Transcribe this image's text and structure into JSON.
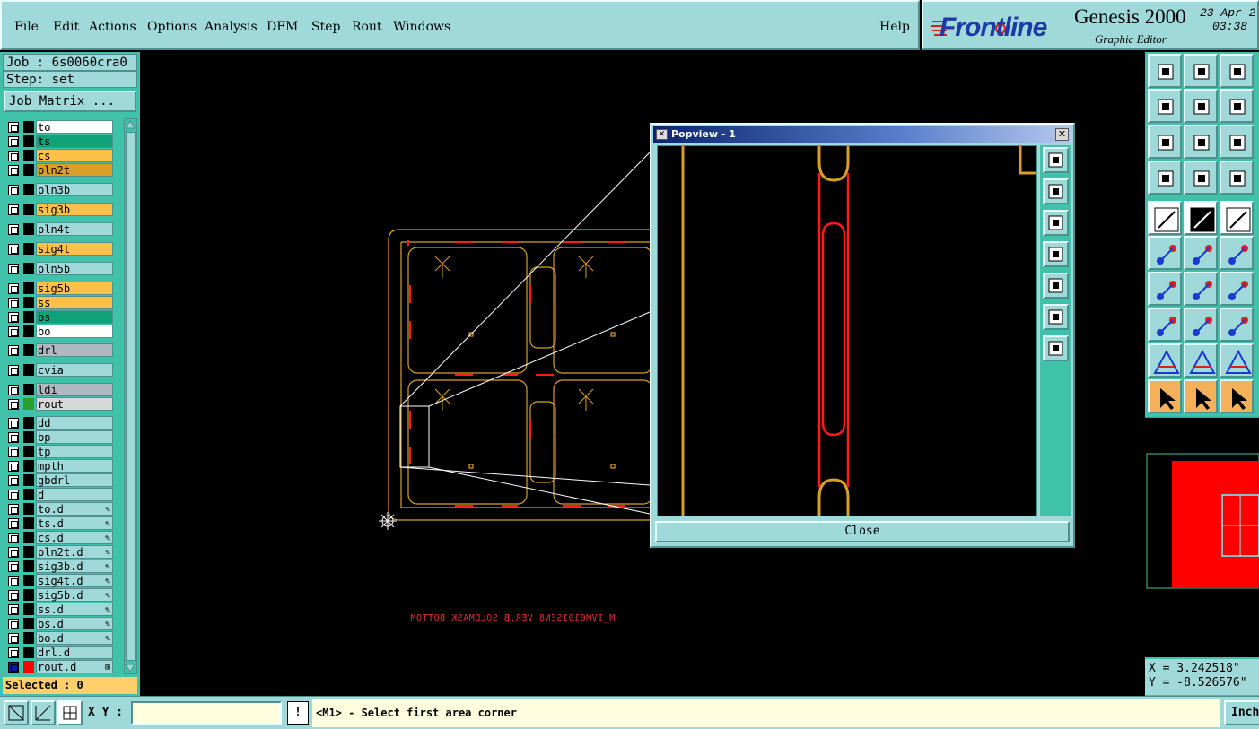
{
  "menu": {
    "items": [
      {
        "label": "File",
        "underline": true
      },
      {
        "label": "Edit",
        "underline": true
      },
      {
        "label": "Actions",
        "underline": true
      },
      {
        "label": "Options",
        "underline": false
      },
      {
        "label": "Analysis",
        "underline": false
      },
      {
        "label": "DFM",
        "underline": false
      },
      {
        "label": "Step",
        "underline": true
      },
      {
        "label": "Rout",
        "underline": true
      },
      {
        "label": "Windows",
        "underline": true
      }
    ],
    "help": "Help"
  },
  "brand": {
    "logo": "Frontline",
    "product": "Genesis 2000",
    "subtitle": "Graphic Editor",
    "date": "23 Apr 2",
    "time": "03:38"
  },
  "job": {
    "job_line": "Job : 6s0060cra0",
    "step_line": "Step: set",
    "matrix_button": "Job Matrix ..."
  },
  "layers": [
    {
      "name": "to",
      "color": "#ffffff",
      "swatch": "#000000",
      "mark": ""
    },
    {
      "name": "ts",
      "color": "#11a27a",
      "swatch": "#000000",
      "mark": ""
    },
    {
      "name": "cs",
      "color": "#ffc04a",
      "swatch": "#000000",
      "mark": ""
    },
    {
      "name": "pln2t",
      "color": "#d9a025",
      "swatch": "#000000",
      "mark": ""
    },
    {
      "name": "pln3b",
      "color": "#9fd9d9",
      "swatch": "#000000",
      "mark": ""
    },
    {
      "name": "sig3b",
      "color": "#ffc04a",
      "swatch": "#000000",
      "mark": ""
    },
    {
      "name": "pln4t",
      "color": "#9fd9d9",
      "swatch": "#000000",
      "mark": ""
    },
    {
      "name": "sig4t",
      "color": "#ffc04a",
      "swatch": "#000000",
      "mark": ""
    },
    {
      "name": "pln5b",
      "color": "#9fd9d9",
      "swatch": "#000000",
      "mark": ""
    },
    {
      "name": "sig5b",
      "color": "#ffc04a",
      "swatch": "#000000",
      "mark": ""
    },
    {
      "name": "ss",
      "color": "#ffc04a",
      "swatch": "#000000",
      "mark": ""
    },
    {
      "name": "bs",
      "color": "#11a27a",
      "swatch": "#000000",
      "mark": ""
    },
    {
      "name": "bo",
      "color": "#ffffff",
      "swatch": "#000000",
      "mark": ""
    },
    {
      "name": "drl",
      "color": "#b0b8c0",
      "swatch": "#000000",
      "mark": ""
    },
    {
      "name": "cvia",
      "color": "#9fd9d9",
      "swatch": "#000000",
      "mark": ""
    },
    {
      "name": "ldi",
      "color": "#b0b8c0",
      "swatch": "#000000",
      "mark": ""
    },
    {
      "name": "rout",
      "color": "#d8d8d8",
      "swatch": "#2aa02a",
      "mark": ""
    },
    {
      "name": "dd",
      "color": "#9fd9d9",
      "swatch": "#000000",
      "mark": ""
    },
    {
      "name": "bp",
      "color": "#9fd9d9",
      "swatch": "#000000",
      "mark": ""
    },
    {
      "name": "tp",
      "color": "#9fd9d9",
      "swatch": "#000000",
      "mark": ""
    },
    {
      "name": "mpth",
      "color": "#9fd9d9",
      "swatch": "#000000",
      "mark": ""
    },
    {
      "name": "gbdrl",
      "color": "#9fd9d9",
      "swatch": "#000000",
      "mark": ""
    },
    {
      "name": "d",
      "color": "#9fd9d9",
      "swatch": "#000000",
      "mark": ""
    },
    {
      "name": "to.d",
      "color": "#9fd9d9",
      "swatch": "#000000",
      "mark": "✎"
    },
    {
      "name": "ts.d",
      "color": "#9fd9d9",
      "swatch": "#000000",
      "mark": "✎"
    },
    {
      "name": "cs.d",
      "color": "#9fd9d9",
      "swatch": "#000000",
      "mark": "✎"
    },
    {
      "name": "pln2t.d",
      "color": "#9fd9d9",
      "swatch": "#000000",
      "mark": "✎"
    },
    {
      "name": "sig3b.d",
      "color": "#9fd9d9",
      "swatch": "#000000",
      "mark": "✎"
    },
    {
      "name": "sig4t.d",
      "color": "#9fd9d9",
      "swatch": "#000000",
      "mark": "✎"
    },
    {
      "name": "sig5b.d",
      "color": "#9fd9d9",
      "swatch": "#000000",
      "mark": "✎"
    },
    {
      "name": "ss.d",
      "color": "#9fd9d9",
      "swatch": "#000000",
      "mark": "✎"
    },
    {
      "name": "bs.d",
      "color": "#9fd9d9",
      "swatch": "#000000",
      "mark": "✎"
    },
    {
      "name": "bo.d",
      "color": "#9fd9d9",
      "swatch": "#000000",
      "mark": "✎"
    },
    {
      "name": "drl.d",
      "color": "#9fd9d9",
      "swatch": "#000000",
      "mark": ""
    },
    {
      "name": "rout.d",
      "color": "#9fd9d9",
      "swatch": "#ff0000",
      "mark": "⊞",
      "checkbox_color": "#1018a0"
    }
  ],
  "selected": "Selected : 0",
  "canvas": {
    "mirror_text": "M_IVM0101SEN8 VER.B SOLDMASK BOTTOM"
  },
  "popview": {
    "title": "Popview - 1",
    "close_button": "Close"
  },
  "coords": {
    "x": "X = 3.242518\"",
    "y": "Y = -8.526576\""
  },
  "bottom": {
    "xy_label": "X Y :",
    "xy_value": "",
    "alert": "!",
    "status": "<M1> - Select first area corner",
    "units": "Inch"
  },
  "colors": {
    "panel": "#9fd9d9",
    "panel_dark": "#3fc2a9",
    "outline": "#d9a025",
    "route": "#ff1a1a"
  }
}
